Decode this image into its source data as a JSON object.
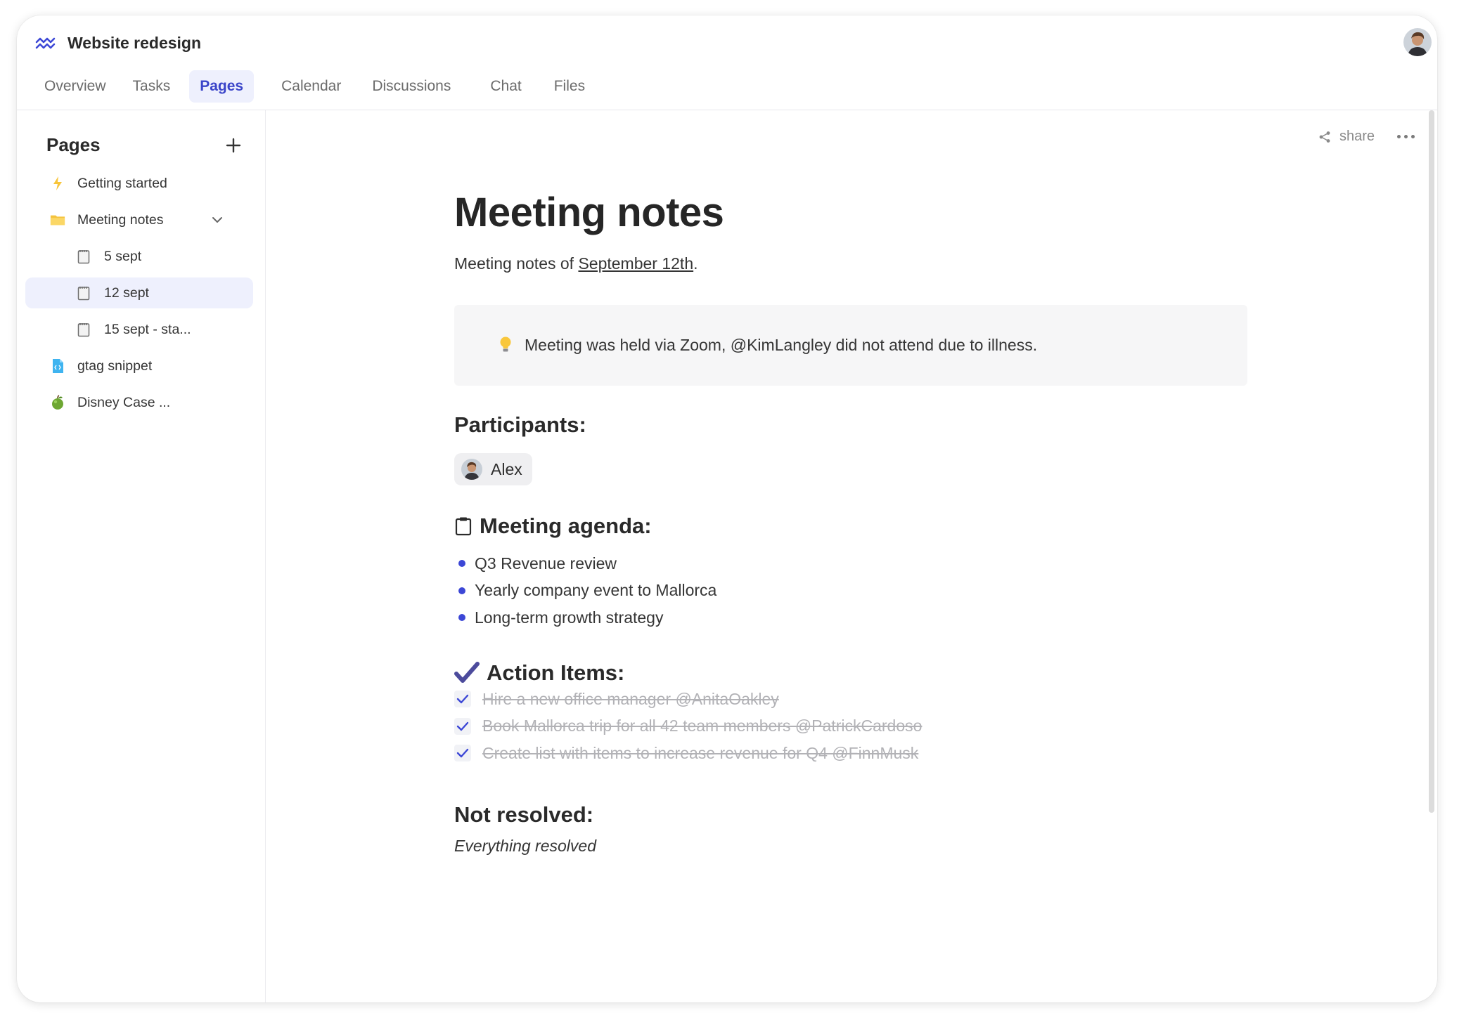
{
  "app": {
    "title": "Website redesign"
  },
  "tabs": [
    {
      "label": "Overview"
    },
    {
      "label": "Tasks"
    },
    {
      "label": "Pages",
      "active": true
    },
    {
      "label": "Calendar"
    },
    {
      "label": "Discussions"
    },
    {
      "label": "Chat"
    },
    {
      "label": "Files"
    }
  ],
  "sidebar": {
    "title": "Pages",
    "items": [
      {
        "label": "Getting started",
        "icon": "lightning-icon"
      },
      {
        "label": "Meeting notes",
        "icon": "folder-icon",
        "expanded": true
      },
      {
        "label": "5 sept",
        "icon": "notepad-icon"
      },
      {
        "label": "12 sept",
        "icon": "notepad-icon",
        "selected": true
      },
      {
        "label": "15 sept - sta...",
        "icon": "notepad-icon"
      },
      {
        "label": "gtag snippet",
        "icon": "code-file-icon"
      },
      {
        "label": "Disney Case ...",
        "icon": "apple-icon"
      }
    ]
  },
  "toolbar": {
    "share_label": "share"
  },
  "page": {
    "title": "Meeting notes",
    "subtitle_prefix": "Meeting notes of ",
    "subtitle_link": "September 12th",
    "subtitle_suffix": ".",
    "callout": "Meeting was held via Zoom, @KimLangley did not attend due to illness.",
    "participants_heading": "Participants:",
    "participant": "Alex",
    "agenda_heading": "Meeting agenda:",
    "agenda": [
      "Q3 Revenue review",
      "Yearly company event to Mallorca",
      "Long-term growth strategy"
    ],
    "action_heading": "Action Items:",
    "actions": [
      "Hire a new office manager @AnitaOakley",
      "Book Mallorca trip for all 42 team members @PatrickCardoso",
      "Create list with items to increase revenue for Q4 @FinnMusk"
    ],
    "unresolved_heading": "Not resolved:",
    "unresolved_text": "Everything resolved"
  },
  "colors": {
    "accent": "#3c47d6",
    "active_tab_bg": "#eef0fd",
    "callout_bg": "#f6f6f7"
  }
}
